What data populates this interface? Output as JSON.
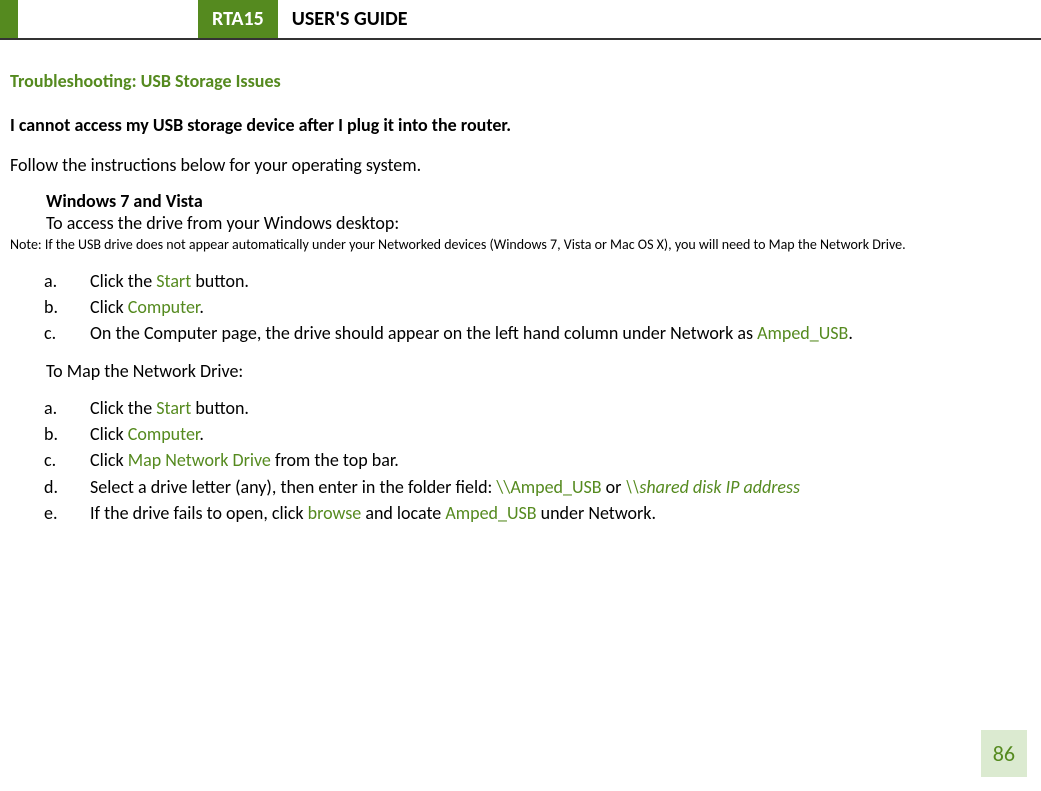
{
  "header": {
    "badge": "RTA15",
    "title": "USER'S GUIDE"
  },
  "section_title": "Troubleshooting: USB Storage Issues",
  "subheading": "I cannot access my USB storage device after I plug it into the router.",
  "intro": "Follow the instructions below for your operating system.",
  "os_heading": "Windows 7 and Vista",
  "os_intro": "To access the drive from your Windows desktop:",
  "note": "Note: If the USB drive does not appear automatically under your Networked devices (Windows 7, Vista or Mac OS X), you will need to Map the Network Drive.",
  "list1": {
    "a": {
      "pre": "Click the ",
      "term": "Start",
      "post": " button."
    },
    "b": {
      "pre": "Click ",
      "term": "Computer",
      "post": "."
    },
    "c": {
      "pre": "On the Computer page, the drive should appear on the left hand column under Network as ",
      "term": "Amped_USB",
      "post": "."
    }
  },
  "map_heading": "To Map the Network Drive:",
  "list2": {
    "a": {
      "pre": "Click the ",
      "term": "Start",
      "post": " button."
    },
    "b": {
      "pre": "Click ",
      "term": "Computer",
      "post": "."
    },
    "c": {
      "pre": "Click ",
      "term": "Map Network Drive",
      "post": " from the top bar."
    },
    "d": {
      "pre": "Select a drive letter (any), then enter in the folder field: ",
      "t1": "\\\\Amped_USB",
      "mid": "    or  ",
      "t2": "\\\\shared disk IP address"
    },
    "e": {
      "pre": "If the drive fails to open, click ",
      "t1": "browse",
      "mid": " and locate ",
      "t2": "Amped_USB",
      "post": " under Network."
    }
  },
  "page_number": "86"
}
